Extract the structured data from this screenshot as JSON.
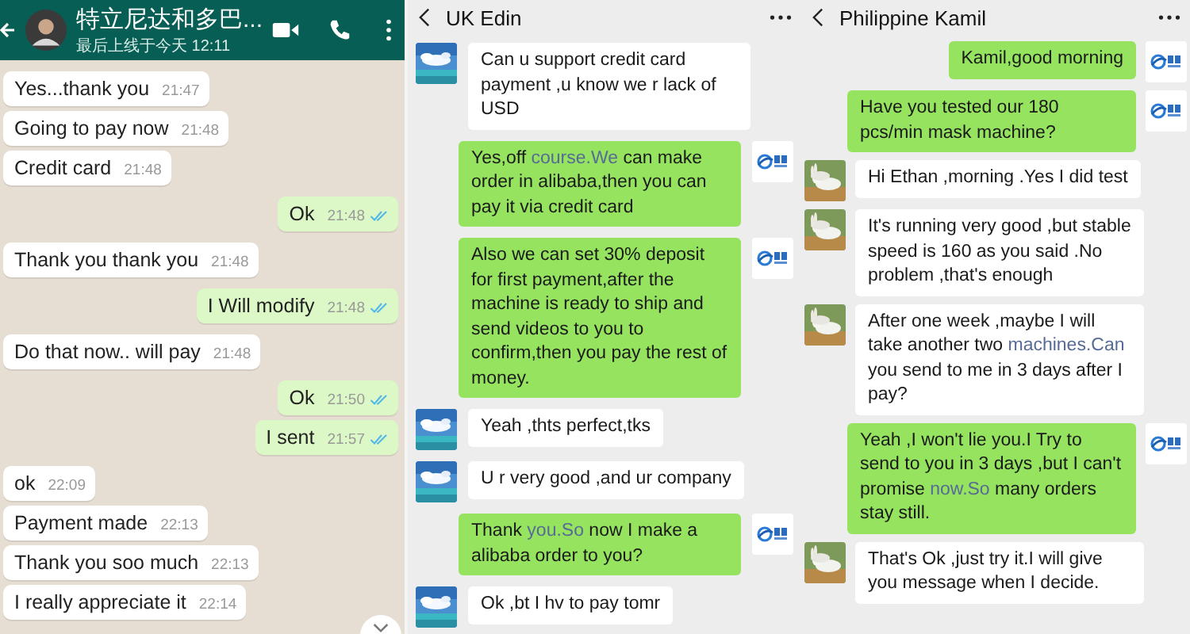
{
  "panels": [
    {
      "kind": "whatsapp",
      "header": {
        "title": "特立尼达和多巴...",
        "status": "最后上线于今天 12:11"
      },
      "messages": [
        {
          "text": "Yes...thank you",
          "time": "21:47",
          "outgoing": false
        },
        {
          "text": "Going to pay now",
          "time": "21:48",
          "outgoing": false
        },
        {
          "text": "Credit card",
          "time": "21:48",
          "outgoing": false
        },
        {
          "text": "Ok",
          "time": "21:48",
          "outgoing": true,
          "read": true
        },
        {
          "text": "Thank you thank you",
          "time": "21:48",
          "outgoing": false
        },
        {
          "text": "I Will modify",
          "time": "21:48",
          "outgoing": true,
          "read": true
        },
        {
          "text": "Do that now.. will pay",
          "time": "21:48",
          "outgoing": false
        },
        {
          "text": "Ok",
          "time": "21:50",
          "outgoing": true,
          "read": true
        },
        {
          "text": "I sent",
          "time": "21:57",
          "outgoing": true,
          "read": true
        },
        {
          "text": "ok",
          "time": "22:09",
          "outgoing": false
        },
        {
          "text": "Payment made",
          "time": "22:13",
          "outgoing": false
        },
        {
          "text": "Thank you soo much",
          "time": "22:13",
          "outgoing": false
        },
        {
          "text": "I really appreciate it",
          "time": "22:14",
          "outgoing": false
        }
      ]
    },
    {
      "kind": "wechat",
      "header": {
        "title": "UK Edin"
      },
      "messages": [
        {
          "outgoing": false,
          "parts": [
            {
              "text": "Can u support credit card payment ,u know we r lack of USD"
            }
          ]
        },
        {
          "outgoing": true,
          "parts": [
            {
              "text": "Yes,off "
            },
            {
              "text": "course.We",
              "kind": "link"
            },
            {
              "text": " can make order in alibaba,then you can pay it via credit card"
            }
          ]
        },
        {
          "outgoing": true,
          "parts": [
            {
              "text": "Also we can set 30% deposit for first payment,after the machine is ready to ship and send videos to you to confirm,then you pay the rest of money."
            }
          ]
        },
        {
          "outgoing": false,
          "parts": [
            {
              "text": "Yeah ,thts perfect,tks"
            }
          ]
        },
        {
          "outgoing": false,
          "parts": [
            {
              "text": "U r very good ,and ur company"
            }
          ]
        },
        {
          "outgoing": true,
          "parts": [
            {
              "text": "Thank "
            },
            {
              "text": "you.So",
              "kind": "link"
            },
            {
              "text": " now I make a alibaba order to you?"
            }
          ]
        },
        {
          "outgoing": false,
          "parts": [
            {
              "text": "Ok ,bt I hv to pay tomr"
            }
          ]
        }
      ]
    },
    {
      "kind": "wechat",
      "header": {
        "title": "Philippine Kamil"
      },
      "messages": [
        {
          "outgoing": true,
          "parts": [
            {
              "text": "Kamil,good morning"
            }
          ]
        },
        {
          "outgoing": true,
          "parts": [
            {
              "text": "Have you tested our 180 pcs/min mask machine?"
            }
          ]
        },
        {
          "outgoing": false,
          "parts": [
            {
              "text": "Hi Ethan ,morning .Yes I did test"
            }
          ]
        },
        {
          "outgoing": false,
          "parts": [
            {
              "text": "It's running very good ,but stable speed is 160 as you said .No problem ,that's enough"
            }
          ]
        },
        {
          "outgoing": false,
          "parts": [
            {
              "text": "After one week ,maybe I will take another two "
            },
            {
              "text": "machines.Can",
              "kind": "link"
            },
            {
              "text": " you send to me in 3 days after I pay?"
            }
          ]
        },
        {
          "outgoing": true,
          "parts": [
            {
              "text": "Yeah ,I won't lie you.I Try to send to you in 3 days ,but I can't promise "
            },
            {
              "text": "now.So",
              "kind": "link"
            },
            {
              "text": " many orders stay still."
            }
          ]
        },
        {
          "outgoing": false,
          "parts": [
            {
              "text": "That's Ok ,just try it.I will give you message when I decide."
            }
          ]
        }
      ]
    }
  ]
}
